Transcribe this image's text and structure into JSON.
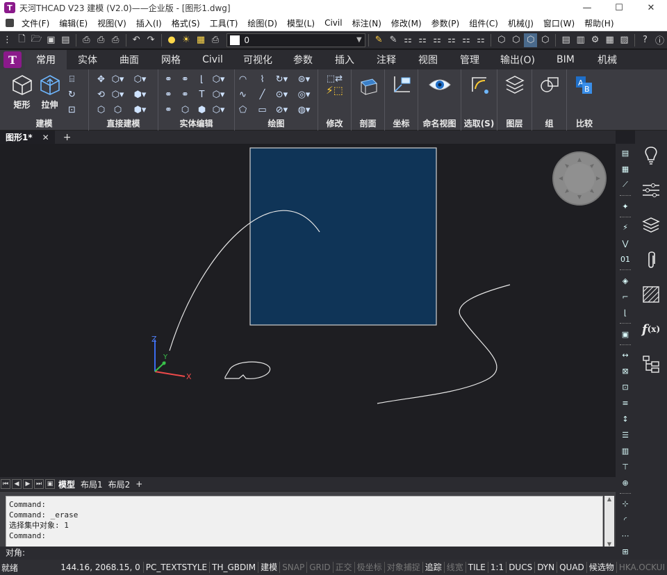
{
  "window": {
    "title": "天河THCAD V23 建模 (V2.0)——企业版 - [图形1.dwg]",
    "minimize": "—",
    "maximize": "☐",
    "close": "✕"
  },
  "menu": [
    "文件(F)",
    "编辑(E)",
    "视图(V)",
    "插入(I)",
    "格式(S)",
    "工具(T)",
    "绘图(D)",
    "模型(L)",
    "Civil",
    "标注(N)",
    "修改(M)",
    "参数(P)",
    "组件(C)",
    "机械(J)",
    "窗口(W)",
    "帮助(H)"
  ],
  "quick_toolbar": {
    "layer_value": "0"
  },
  "ribbon_tabs": [
    "常用",
    "实体",
    "曲面",
    "网格",
    "Civil",
    "可视化",
    "参数",
    "插入",
    "注释",
    "视图",
    "管理",
    "输出(O)",
    "BIM",
    "机械"
  ],
  "active_tab": "常用",
  "ribbon_groups": {
    "modeling": {
      "label": "建模",
      "btn_rect": "矩形",
      "btn_extrude": "拉伸"
    },
    "direct": {
      "label": "直接建模"
    },
    "solid_edit": {
      "label": "实体编辑"
    },
    "draw": {
      "label": "绘图"
    },
    "modify": {
      "label": "修改"
    },
    "section": {
      "label": "剖面"
    },
    "ucs": {
      "label": "坐标"
    },
    "named_view": {
      "label": "命名视图"
    },
    "select": {
      "label": "选取(S)"
    },
    "layers": {
      "label": "图层"
    },
    "group": {
      "label": "组"
    },
    "compare": {
      "label": "比较"
    }
  },
  "doc_tab": {
    "name": "图形1*",
    "close": "✕",
    "add": "+"
  },
  "layout_tabs": [
    "模型",
    "布局1",
    "布局2",
    "+"
  ],
  "axes": {
    "x": "X",
    "y": "Y",
    "z": "Z"
  },
  "command_history": [
    "Command:",
    "Command:  _erase",
    "选择集中对象:  1",
    "Command:"
  ],
  "command_prompt": "对角:",
  "status": {
    "ready": "就绪",
    "coords": "144.16, 2068.15, 0",
    "items": [
      {
        "label": "PC_TEXTSTYLE",
        "on": true
      },
      {
        "label": "TH_GBDIM",
        "on": true
      },
      {
        "label": "建模",
        "on": true
      },
      {
        "label": "SNAP",
        "on": false
      },
      {
        "label": "GRID",
        "on": false
      },
      {
        "label": "正交",
        "on": false
      },
      {
        "label": "极坐标",
        "on": false
      },
      {
        "label": "对象捕捉",
        "on": false
      },
      {
        "label": "追踪",
        "on": true
      },
      {
        "label": "线宽",
        "on": false
      },
      {
        "label": "TILE",
        "on": true
      },
      {
        "label": "1:1",
        "on": true
      },
      {
        "label": "DUCS",
        "on": true
      },
      {
        "label": "DYN",
        "on": true
      },
      {
        "label": "QUAD",
        "on": true
      },
      {
        "label": "候选物",
        "on": true
      },
      {
        "label": "HKA.OCKUI",
        "on": false
      }
    ]
  },
  "colors": {
    "selection_fill": "#0f3457",
    "selection_border": "#d0d0d0",
    "accent": "#8b1a8b"
  }
}
